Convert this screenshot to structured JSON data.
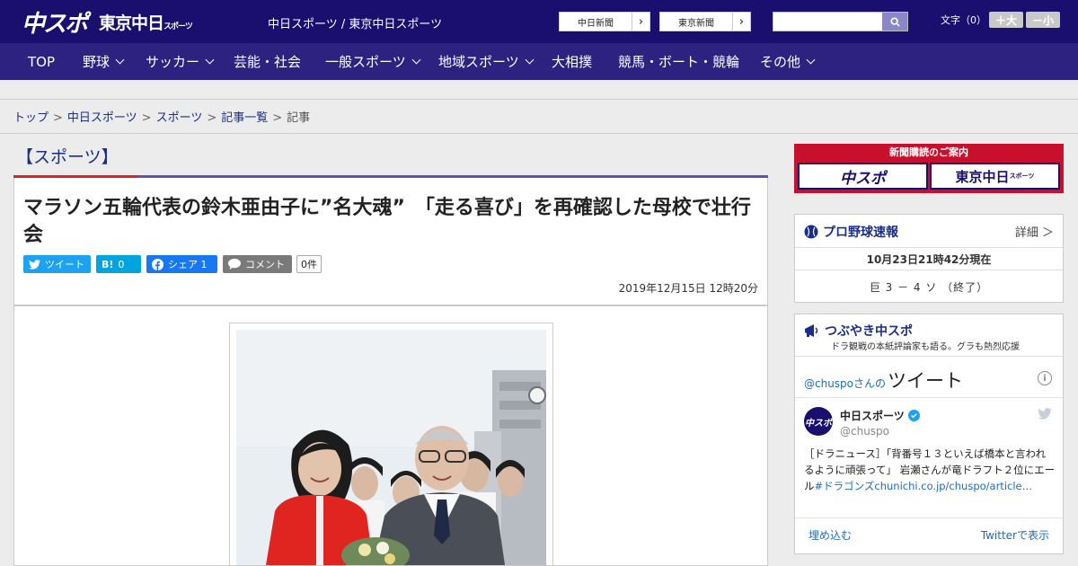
{
  "header": {
    "logo_main": "中スポ",
    "logo_tokyo": "東京中日",
    "logo_tokyo_sub": "スポーツ",
    "site_names": "中日スポーツ / 東京中日スポーツ",
    "ext_links": [
      "中日新聞",
      "東京新聞"
    ],
    "search_placeholder": "",
    "font_size_label": "文字（0）",
    "font_bigger": "＋大",
    "font_smaller": "－小"
  },
  "nav": {
    "items": [
      "TOP",
      "野球",
      "サッカー",
      "芸能・社会",
      "一般スポーツ",
      "地域スポーツ",
      "大相撲",
      "競馬・ボート・競輪",
      "その他"
    ]
  },
  "breadcrumb": {
    "links": [
      "トップ",
      "中日スポーツ",
      "スポーツ",
      "記事一覧"
    ],
    "current": "記事",
    "separator": ">"
  },
  "section_title": "【スポーツ】",
  "article": {
    "headline": "マラソン五輪代表の鈴木亜由子に”名大魂”　「走る喜び」を再確認した母校で壮行会",
    "share": {
      "tweet": "ツイート",
      "hatena_icon": "B!",
      "hatena_count": "0",
      "facebook": "シェア",
      "facebook_count": "1",
      "comment": "コメント",
      "comment_count": "0件"
    },
    "date": "2019年12月15日 12時20分"
  },
  "sidebar": {
    "promo": {
      "title": "新聞購読のご案内",
      "left": "中スポ",
      "right": "東京中日",
      "right_sub": "スポーツ"
    },
    "baseball": {
      "title": "プロ野球速報",
      "detail": "詳細 ＞",
      "updated": "10月23日21時42分現在",
      "score": "巨 3 － 4 ソ （終了）"
    },
    "tweets": {
      "title": "つぶやき中スポ",
      "subtitle": "ドラ観戦の本紙評論家も語る。グラも熱烈応援",
      "handle_line": "@chuspoさんの",
      "tweet_word": "ツイート",
      "account_name": "中日スポーツ",
      "account_handle": "@chuspo",
      "tweet_text": "［ドラニュース］「背番号１３といえば橋本と言われるように頑張って」 岩瀬さんが竜ドラフト２位にエール",
      "tweet_link": "#ドラゴンズchunichi.co.jp/chuspo/article…",
      "embed": "埋め込む",
      "view_on": "Twitterで表示"
    }
  },
  "colors": {
    "header_bg": "#1a0f6e",
    "nav_bg": "#2d2280",
    "accent_red": "#d8232a",
    "link_blue": "#1a2d8a",
    "twitter": "#1da1f2",
    "hatena": "#00a4de",
    "facebook": "#1877f2"
  }
}
